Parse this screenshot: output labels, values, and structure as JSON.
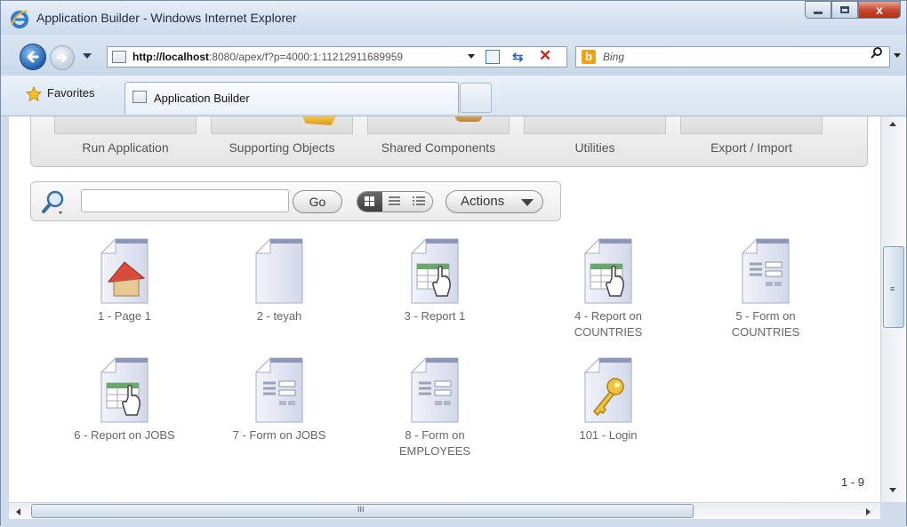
{
  "window": {
    "title": "Application Builder - Windows Internet Explorer",
    "close_glyph": "x"
  },
  "nav": {
    "url_host": "http://localhost",
    "url_rest": ":8080/apex/f?p=4000:1:11212911689959",
    "search_placeholder": "Bing"
  },
  "favorites": {
    "label": "Favorites",
    "tab_label": "Application Builder"
  },
  "app_toolbar": {
    "items": [
      "Run Application",
      "Supporting Objects",
      "Shared Components",
      "Utilities",
      "Export / Import"
    ]
  },
  "search_toolbar": {
    "go_label": "Go",
    "actions_label": "Actions"
  },
  "pages": [
    {
      "label": "1 - Page 1",
      "icon": "home-page-icon"
    },
    {
      "label": "2 - teyah",
      "icon": "blank-page-icon"
    },
    {
      "label": "3 - Report 1",
      "icon": "report-page-icon"
    },
    {
      "label": "4 - Report on COUNTRIES",
      "icon": "report-page-icon"
    },
    {
      "label": "5 - Form on COUNTRIES",
      "icon": "form-page-icon"
    },
    {
      "label": "6 - Report on JOBS",
      "icon": "report-page-icon"
    },
    {
      "label": "7 - Form on JOBS",
      "icon": "form-page-icon"
    },
    {
      "label": "8 - Form on EMPLOYEES",
      "icon": "form-page-icon"
    },
    {
      "label": "101 - Login",
      "icon": "login-page-icon"
    }
  ],
  "pagination": "1 - 9",
  "colors": {
    "accent": "#1f5fae",
    "label": "#666666"
  }
}
